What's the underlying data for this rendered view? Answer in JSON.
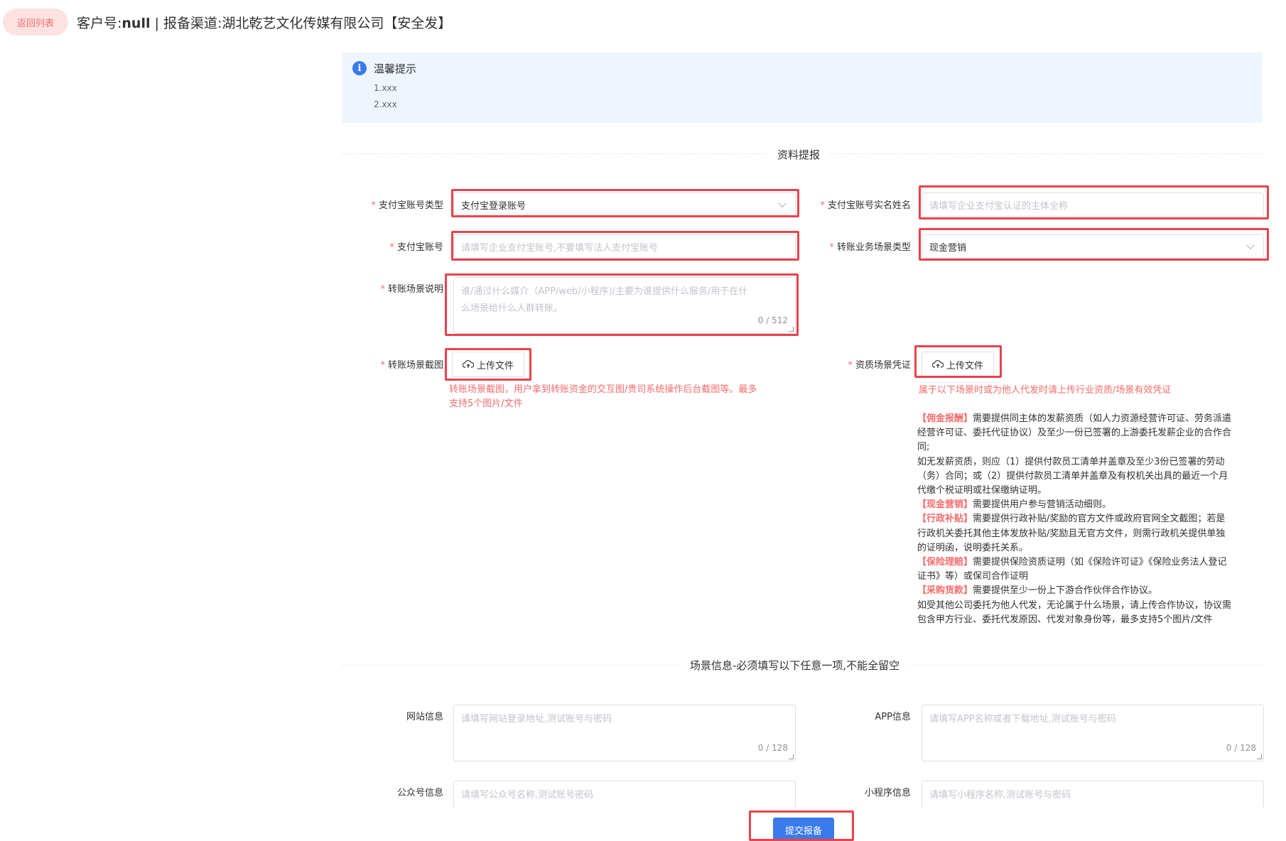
{
  "header": {
    "back_label": "返回列表",
    "title_prefix": "客户号:",
    "customer_no": "null",
    "title_sep": " | 报备渠道:湖北乾艺文化传媒有限公司【安全发】"
  },
  "tip": {
    "icon": "info-icon",
    "title": "温馨提示",
    "lines": [
      "1.xxx",
      "2.xxx"
    ]
  },
  "section1": {
    "title": "资料提报"
  },
  "form": {
    "alipay_type": {
      "label": "支付宝账号类型",
      "value": "支付宝登录账号"
    },
    "alipay_name": {
      "label": "支付宝账号实名姓名",
      "placeholder": "请填写企业支付宝认证的主体全称"
    },
    "alipay_account": {
      "label": "支付宝账号",
      "placeholder": "请填写企业支付宝账号,不要填写法人支付宝账号"
    },
    "scene_type": {
      "label": "转账业务场景类型",
      "value": "现金营销"
    },
    "scene_desc": {
      "label": "转账场景说明",
      "placeholder_line1": "谁/通过什么媒介（APP/web/小程序)/主要为谁提供什么服务/用于在什",
      "placeholder_line2": "么场景给什么人群转账。",
      "counter": "0 / 512"
    },
    "scene_screenshot": {
      "label": "转账场景截图",
      "upload_label": "上传文件",
      "note_line1": "转账场景截图，用户拿到转账资金的交互图/贵司系统操作后台截图等。最多",
      "note_line2": "支持5个图片/文件"
    },
    "qualification": {
      "label": "资质场景凭证",
      "upload_label": "上传文件",
      "note": "属于以下场景时或为他人代发时请上传行业资质/场景有效凭证",
      "tag_commission": "【佣金报酬】",
      "commission_1": "需要提供同主体的发薪资质（如人力资源经营许可证、劳务派遣",
      "commission_2": "经营许可证、委托代征协议）及至少一份已签署的上游委托发薪企业的合作合",
      "commission_3": "同;",
      "nopay_1": "如无发薪资质，则应（1）提供付款员工清单并盖章及至少3份已签署的劳动",
      "nopay_2": "（务）合同；或（2）提供付款员工清单并盖章及有权机关出具的最近一个月",
      "nopay_3": "代缴个税证明或社保缴纳证明。",
      "tag_cash": "【现金营销】",
      "cash": "需要提供用户参与营销活动细则。",
      "tag_subsidy": "【行政补贴】",
      "subsidy_1": "需要提供行政补贴/奖励的官方文件或政府官网全文截图；若是",
      "subsidy_2": "行政机关委托其他主体发放补贴/奖励且无官方文件，则需行政机关提供单独",
      "subsidy_3": "的证明函，说明委托关系。",
      "tag_insurance": "【保险理赔】",
      "insurance_1": "需要提供保险资质证明（如《保险许可证》《保险业务法人登记",
      "insurance_2": "证书》等）或保司合作证明",
      "tag_purchase": "【采购货款】",
      "purchase": "需要提供至少一份上下游合作伙伴合作协议。",
      "agent_1": "如受其他公司委托为他人代发，无论属于什么场景，请上传合作协议，协议需",
      "agent_2": "包含甲方行业、委托代发原因、代发对象身份等，最多支持5个图片/文件"
    }
  },
  "section2": {
    "title": "场景信息-必须填写以下任意一项,不能全留空"
  },
  "scene_info": {
    "website": {
      "label": "网站信息",
      "placeholder": "请填写网站登录地址,测试账号与密码",
      "counter": "0 / 128"
    },
    "app": {
      "label": "APP信息",
      "placeholder": "请填写APP名称或者下载地址,测试账号与密码",
      "counter": "0 / 128"
    },
    "official": {
      "label": "公众号信息",
      "placeholder": "请填写公众号名称,测试账号密码"
    },
    "miniprogram": {
      "label": "小程序信息",
      "placeholder": "请填写小程序名称,测试账号与密码"
    }
  },
  "submit_label": "提交报备",
  "colors": {
    "accent": "#3a7bec",
    "danger": "#f56c6c",
    "highlight": "#e8434c",
    "tip_bg": "#eef5fe"
  }
}
